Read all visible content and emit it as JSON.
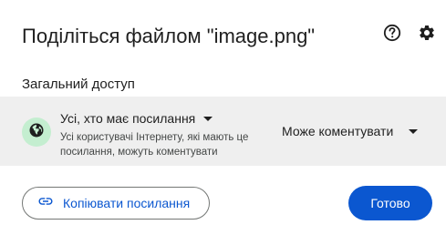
{
  "dialog": {
    "title": "Поділіться файлом \"image.png\"",
    "help_icon": "help-circle-icon",
    "settings_icon": "gear-icon"
  },
  "general_access": {
    "section_label": "Загальний доступ",
    "icon": "globe-icon",
    "access_level": "Усі, хто має посилання",
    "description": "Усі користувачі Інтернету, які мають це посилання, можуть коментувати",
    "role": "Може коментувати"
  },
  "footer": {
    "copy_link_label": "Копіювати посилання",
    "copy_link_icon": "link-icon",
    "done_label": "Готово"
  },
  "colors": {
    "accent": "#0b57d0",
    "globe_badge": "#c4eed0",
    "access_row_bg": "#efefef"
  }
}
